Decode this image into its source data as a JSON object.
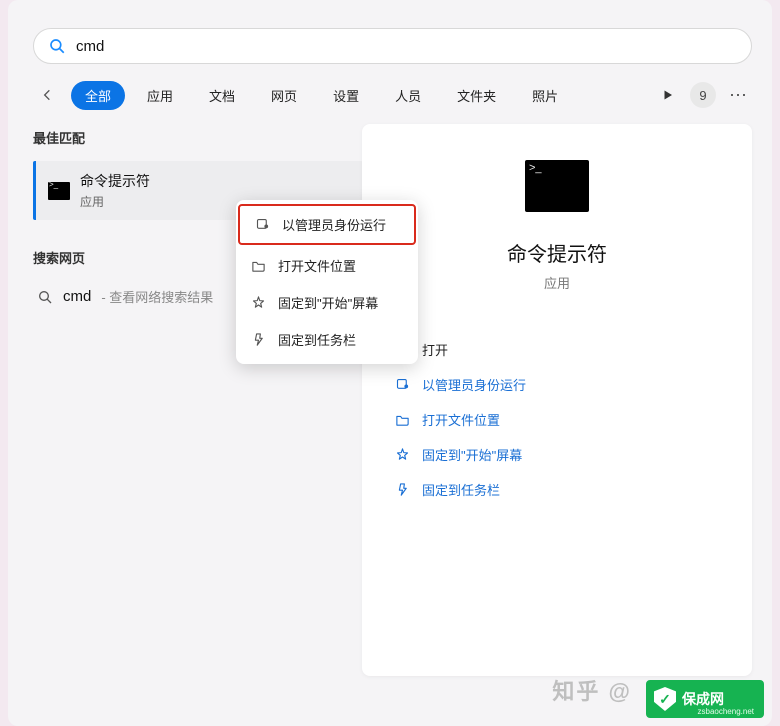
{
  "search": {
    "query": "cmd"
  },
  "filters": {
    "items": [
      {
        "label": "全部",
        "active": true
      },
      {
        "label": "应用"
      },
      {
        "label": "文档"
      },
      {
        "label": "网页"
      },
      {
        "label": "设置"
      },
      {
        "label": "人员"
      },
      {
        "label": "文件夹"
      },
      {
        "label": "照片"
      }
    ],
    "badge": "9"
  },
  "sections": {
    "best_match": "最佳匹配",
    "search_web": "搜索网页"
  },
  "best": {
    "title": "命令提示符",
    "subtitle": "应用"
  },
  "web": {
    "term": "cmd",
    "hint": " - 查看网络搜索结果"
  },
  "detail": {
    "title": "命令提示符",
    "subtitle": "应用",
    "actions": [
      {
        "icon": "open",
        "label": "打开",
        "plain": true
      },
      {
        "icon": "admin",
        "label": "以管理员身份运行"
      },
      {
        "icon": "folder",
        "label": "打开文件位置"
      },
      {
        "icon": "pin-start",
        "label": "固定到\"开始\"屏幕"
      },
      {
        "icon": "pin-taskbar",
        "label": "固定到任务栏"
      }
    ]
  },
  "context_menu": [
    {
      "icon": "admin",
      "label": "以管理员身份运行",
      "highlight": true
    },
    {
      "icon": "folder",
      "label": "打开文件位置"
    },
    {
      "icon": "pin-start",
      "label": "固定到\"开始\"屏幕"
    },
    {
      "icon": "pin-taskbar",
      "label": "固定到任务栏"
    }
  ],
  "watermarks": {
    "zhihu": "知乎 @",
    "logo_text": "保成网",
    "logo_sub": "zsbaocheng.net"
  }
}
